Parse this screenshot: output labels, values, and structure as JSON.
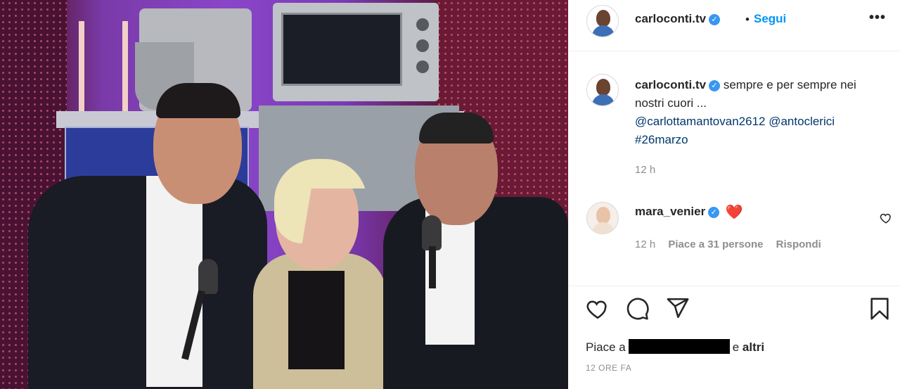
{
  "post": {
    "author": "carloconti.tv",
    "follow_label": "Segui",
    "more_label": "•••",
    "caption_user": "carloconti.tv",
    "caption_text": "sempre e per sempre nei nostri cuori ...",
    "mention1": "@carlottamantovan2612",
    "mention2": "@antoclerici",
    "hashtag": "#26marzo",
    "caption_time": "12 h"
  },
  "comment": {
    "user": "mara_venier",
    "text": "❤️",
    "time": "12 h",
    "likes": "Piace a 31 persone",
    "reply": "Rispondi"
  },
  "footer": {
    "likes_prefix": "Piace a",
    "likes_suffix_e": "e",
    "likes_suffix_altri": "altri",
    "post_time": "12 ORE FA"
  },
  "icons": {
    "like": "heart-icon",
    "comment": "comment-icon",
    "share": "send-icon",
    "save": "bookmark-icon",
    "verified": "verified-badge-icon"
  },
  "colors": {
    "link": "#00376b",
    "follow": "#0095f6",
    "verified": "#3897f0",
    "meta": "#8e8e8e"
  }
}
